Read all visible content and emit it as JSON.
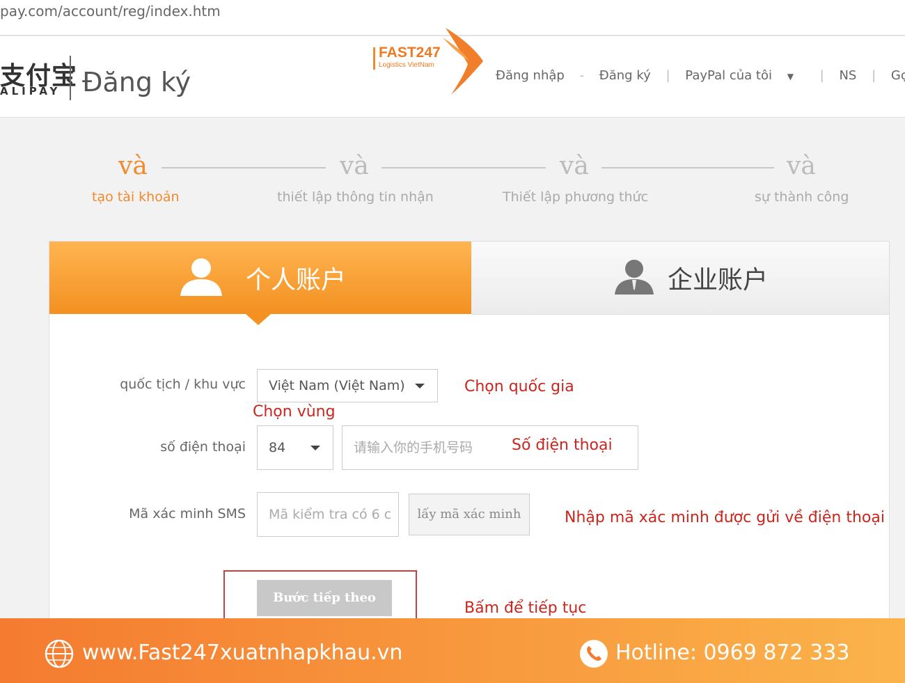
{
  "browser": {
    "url": "pay.com/account/reg/index.htm"
  },
  "header": {
    "logo_cn": "支付宝",
    "logo_en": "ALIPAY",
    "page_title": "Đăng ký",
    "brand_name": "FAST247",
    "brand_sub": "Logistics VietNam",
    "nav": [
      "Đăng nhập",
      "Đăng ký",
      "PayPal của tôi",
      "NS",
      "Gợi ý"
    ]
  },
  "steps": [
    {
      "num": "và",
      "label": "tạo tài khoản",
      "active": true
    },
    {
      "num": "và",
      "label": "thiết lập thông tin nhận",
      "active": false
    },
    {
      "num": "và",
      "label": "Thiết lập phương thức",
      "active": false
    },
    {
      "num": "và",
      "label": "sự thành công",
      "active": false
    }
  ],
  "tabs": {
    "personal": "个人账户",
    "business": "企业账户"
  },
  "form": {
    "nationality_label": "quốc tịch / khu vực",
    "nationality_value": "Việt Nam (Việt Nam)",
    "phone_label": "số điện thoại",
    "country_code": "84",
    "phone_placeholder": "请输入你的手机号码",
    "sms_label": "Mã xác minh SMS",
    "sms_placeholder": "Mã kiểm tra có 6 c",
    "get_code": "lấy mã xác minh",
    "next": "Bước tiếp theo"
  },
  "annotations": {
    "choose_country": "Chọn quốc gia",
    "choose_region": "Chọn vùng",
    "phone_number": "Số điện thoại",
    "enter_code": "Nhập mã xác minh được gửi về điện thoại",
    "click_continue": "Bấm để tiếp tục"
  },
  "footer": {
    "website": "www.Fast247xuatnhapkhau.vn",
    "hotline": "Hotline: 0969 872 333"
  },
  "colors": {
    "accent": "#f39121",
    "annotation": "#c8261e",
    "footer_start": "#f47b30",
    "footer_end": "#fbb34a"
  },
  "icons": [
    "user-icon",
    "business-user-icon",
    "globe-icon",
    "phone-icon",
    "chevron-down-icon"
  ]
}
